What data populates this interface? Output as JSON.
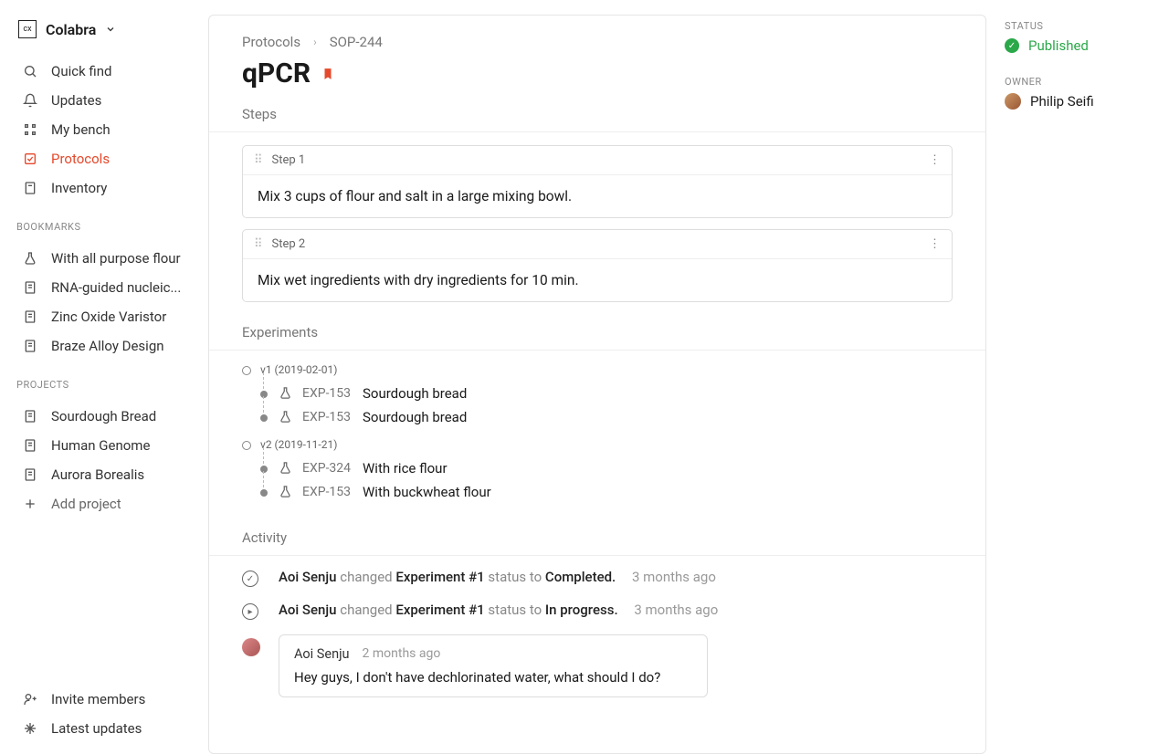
{
  "workspace": {
    "name": "Colabra",
    "logo_text": "cx"
  },
  "nav": {
    "quick_find": "Quick find",
    "updates": "Updates",
    "my_bench": "My bench",
    "protocols": "Protocols",
    "inventory": "Inventory"
  },
  "sections": {
    "bookmarks": "Bookmarks",
    "projects": "Projects"
  },
  "bookmarks": [
    {
      "label": "With all purpose flour",
      "icon": "flask"
    },
    {
      "label": "RNA-guided nucleic...",
      "icon": "doc"
    },
    {
      "label": "Zinc Oxide Varistor",
      "icon": "doc"
    },
    {
      "label": "Braze Alloy Design",
      "icon": "doc"
    }
  ],
  "projects": [
    {
      "label": "Sourdough Bread"
    },
    {
      "label": "Human Genome"
    },
    {
      "label": "Aurora Borealis"
    }
  ],
  "add_project": "Add project",
  "footer": {
    "invite": "Invite members",
    "latest": "Latest updates"
  },
  "breadcrumb": {
    "root": "Protocols",
    "id": "SOP-244"
  },
  "title": "qPCR",
  "labels": {
    "steps": "Steps",
    "experiments": "Experiments",
    "activity": "Activity"
  },
  "steps": [
    {
      "header": "Step 1",
      "body": "Mix 3 cups of flour and salt in a large mixing bowl."
    },
    {
      "header": "Step 2",
      "body": "Mix wet ingredients with dry ingredients for 10 min."
    }
  ],
  "experiments": [
    {
      "version": "v1 (2019-02-01)",
      "items": [
        {
          "id": "EXP-153",
          "name": "Sourdough bread"
        },
        {
          "id": "EXP-153",
          "name": "Sourdough bread"
        }
      ]
    },
    {
      "version": "v2 (2019-11-21)",
      "items": [
        {
          "id": "EXP-324",
          "name": "With rice flour"
        },
        {
          "id": "EXP-153",
          "name": "With buckwheat flour"
        }
      ]
    }
  ],
  "activity": [
    {
      "user": "Aoi Senju",
      "mid": " changed ",
      "subject": "Experiment #1",
      "mid2": " status to ",
      "status": "Completed.",
      "time": "3 months ago",
      "icon": "check"
    },
    {
      "user": "Aoi Senju",
      "mid": " changed ",
      "subject": "Experiment #1",
      "mid2": " status to ",
      "status": "In progress.",
      "time": "3 months ago",
      "icon": "play"
    }
  ],
  "comment": {
    "author": "Aoi Senju",
    "time": "2 months ago",
    "body": "Hey guys, I don't have dechlorinated water, what should I do?"
  },
  "meta": {
    "status_label": "Status",
    "status_value": "Published",
    "owner_label": "Owner",
    "owner_value": "Philip Seifi"
  }
}
